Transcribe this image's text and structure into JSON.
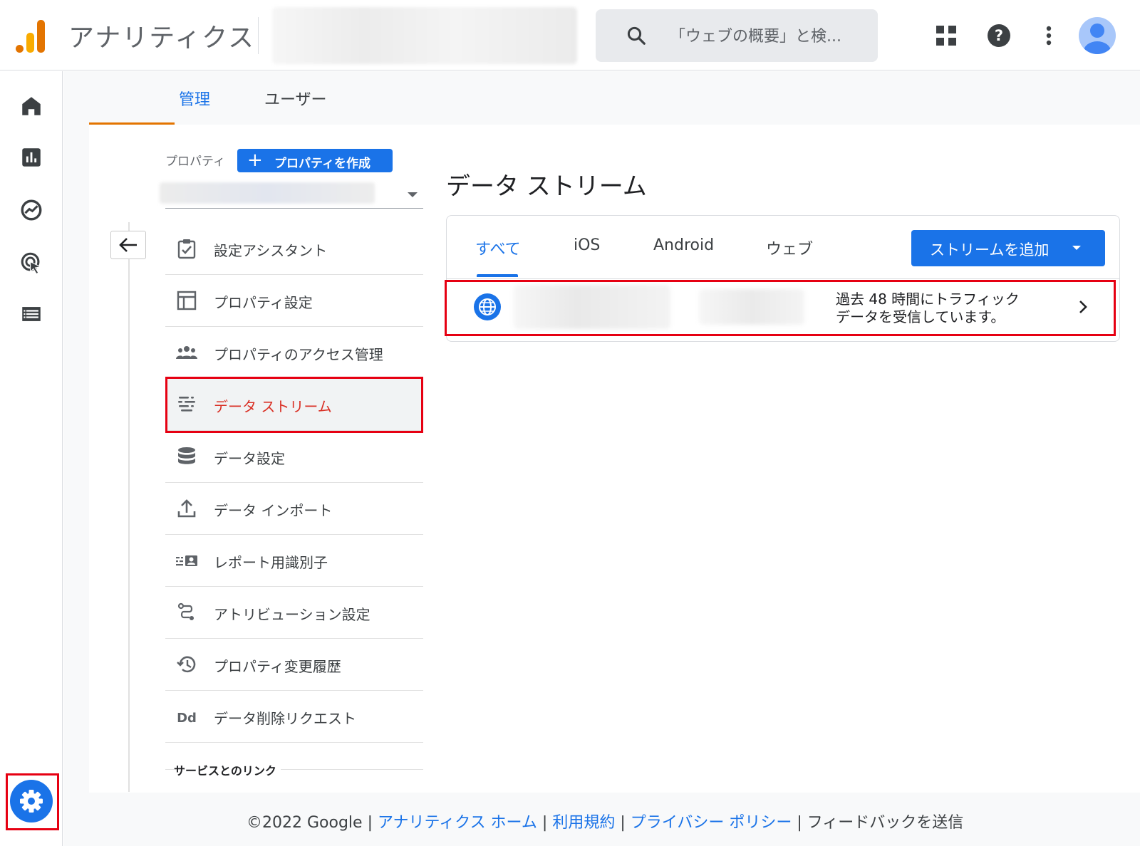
{
  "header": {
    "app_title": "アナリティクス",
    "search_placeholder": "「ウェブの概要」と検..."
  },
  "rail": {
    "items": [
      "home-icon",
      "reports-icon",
      "explore-icon",
      "advertising-icon",
      "configure-icon"
    ],
    "settings_icon": "gear-icon"
  },
  "tabs": {
    "admin": "管理",
    "user": "ユーザー"
  },
  "property": {
    "label": "プロパティ",
    "create_button": "プロパティを作成",
    "menu": [
      {
        "label": "設定アシスタント",
        "icon": "checklist-icon"
      },
      {
        "label": "プロパティ設定",
        "icon": "layout-icon"
      },
      {
        "label": "プロパティのアクセス管理",
        "icon": "people-icon"
      },
      {
        "label": "データ ストリーム",
        "icon": "streams-icon"
      },
      {
        "label": "データ設定",
        "icon": "database-icon"
      },
      {
        "label": "データ インポート",
        "icon": "upload-icon"
      },
      {
        "label": "レポート用識別子",
        "icon": "identifier-icon"
      },
      {
        "label": "アトリビューション設定",
        "icon": "attribution-icon"
      },
      {
        "label": "プロパティ変更履歴",
        "icon": "history-icon"
      },
      {
        "label": "データ削除リクエスト",
        "icon": "dd-icon"
      }
    ],
    "section_heading": "サービスとのリンク"
  },
  "data_streams": {
    "title": "データ ストリーム",
    "tabs": [
      "すべて",
      "iOS",
      "Android",
      "ウェブ"
    ],
    "active_tab": "すべて",
    "add_button": "ストリームを追加",
    "stream_status_line1": "過去 48 時間にトラフィック",
    "stream_status_line2": "データを受信しています。"
  },
  "footer": {
    "copyright": "©2022 Google",
    "link_home": "アナリティクス ホーム",
    "link_terms": "利用規約",
    "link_privacy": "プライバシー ポリシー",
    "feedback": "フィードバックを送信",
    "separator": "|"
  },
  "colors": {
    "accent": "#1a73e8",
    "highlight_box": "#e60012",
    "active_menu_text": "#d93025",
    "tab_underline": "#e37400"
  }
}
